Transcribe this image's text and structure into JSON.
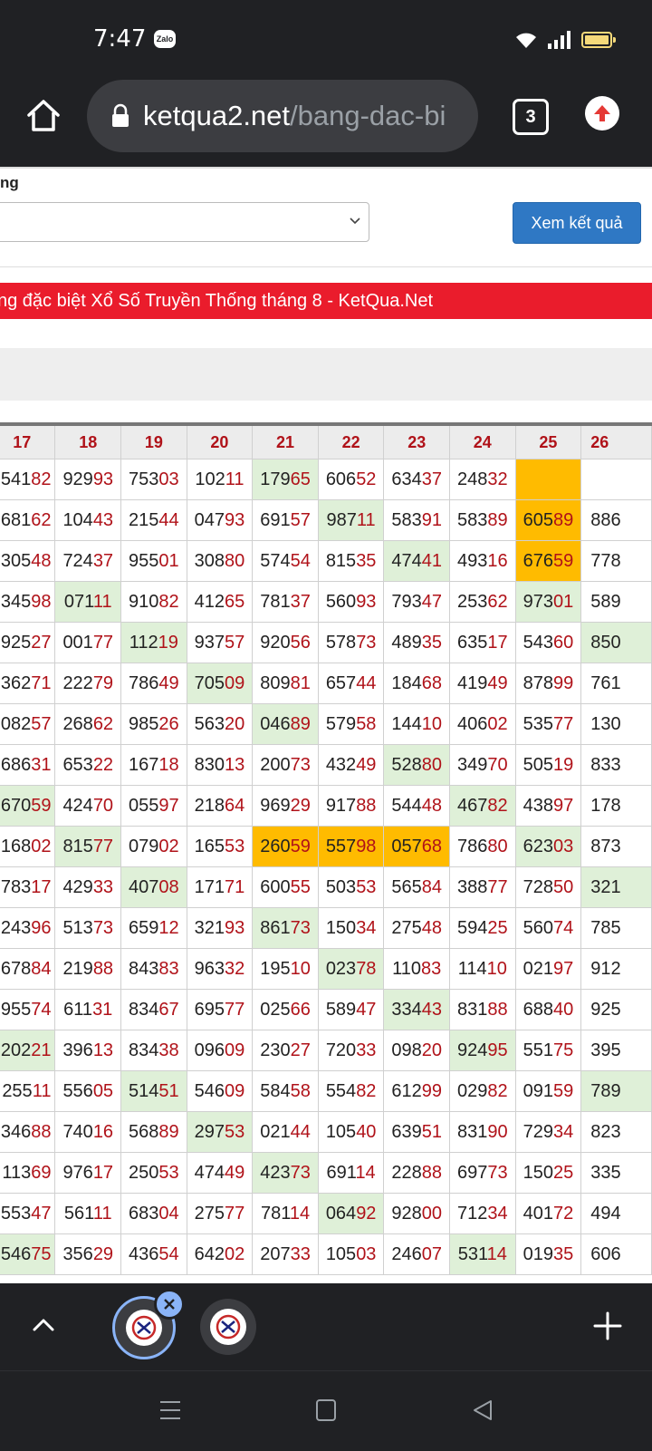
{
  "status": {
    "time": "7:47",
    "notification_icon_label": "Zalo"
  },
  "browser": {
    "url_host": "ketqua2.net",
    "url_path": "/bang-dac-bi",
    "tab_count": "3"
  },
  "form": {
    "label": "ng",
    "submit_label": "Xem kết quả"
  },
  "banner": {
    "title": "ng đặc biệt Xổ Số Truyền Thống tháng 8 - KetQua.Net"
  },
  "table": {
    "headers": [
      "17",
      "18",
      "19",
      "20",
      "21",
      "22",
      "23",
      "24",
      "25",
      "26"
    ],
    "rows": [
      [
        {
          "t": "54182",
          "h": ""
        },
        {
          "t": "92993",
          "h": ""
        },
        {
          "t": "75303",
          "h": ""
        },
        {
          "t": "10211",
          "h": ""
        },
        {
          "t": "17965",
          "h": "g"
        },
        {
          "t": "60652",
          "h": ""
        },
        {
          "t": "63437",
          "h": ""
        },
        {
          "t": "24832",
          "h": ""
        },
        {
          "t": "",
          "h": "o"
        },
        {
          "t": "",
          "h": ""
        }
      ],
      [
        {
          "t": "68162",
          "h": ""
        },
        {
          "t": "10443",
          "h": ""
        },
        {
          "t": "21544",
          "h": ""
        },
        {
          "t": "04793",
          "h": ""
        },
        {
          "t": "69157",
          "h": ""
        },
        {
          "t": "98711",
          "h": "g"
        },
        {
          "t": "58391",
          "h": ""
        },
        {
          "t": "58389",
          "h": ""
        },
        {
          "t": "60589",
          "h": "o"
        },
        {
          "t": "886",
          "h": ""
        }
      ],
      [
        {
          "t": "30548",
          "h": ""
        },
        {
          "t": "72437",
          "h": ""
        },
        {
          "t": "95501",
          "h": ""
        },
        {
          "t": "30880",
          "h": ""
        },
        {
          "t": "57454",
          "h": ""
        },
        {
          "t": "81535",
          "h": ""
        },
        {
          "t": "47441",
          "h": "g"
        },
        {
          "t": "49316",
          "h": ""
        },
        {
          "t": "67659",
          "h": "o"
        },
        {
          "t": "778",
          "h": ""
        }
      ],
      [
        {
          "t": "34598",
          "h": ""
        },
        {
          "t": "07111",
          "h": "g"
        },
        {
          "t": "91082",
          "h": ""
        },
        {
          "t": "41265",
          "h": ""
        },
        {
          "t": "78137",
          "h": ""
        },
        {
          "t": "56093",
          "h": ""
        },
        {
          "t": "79347",
          "h": ""
        },
        {
          "t": "25362",
          "h": ""
        },
        {
          "t": "97301",
          "h": "g"
        },
        {
          "t": "589",
          "h": ""
        }
      ],
      [
        {
          "t": "92527",
          "h": ""
        },
        {
          "t": "00177",
          "h": ""
        },
        {
          "t": "11219",
          "h": "g"
        },
        {
          "t": "93757",
          "h": ""
        },
        {
          "t": "92056",
          "h": ""
        },
        {
          "t": "57873",
          "h": ""
        },
        {
          "t": "48935",
          "h": ""
        },
        {
          "t": "63517",
          "h": ""
        },
        {
          "t": "54360",
          "h": ""
        },
        {
          "t": "850",
          "h": "g"
        }
      ],
      [
        {
          "t": "36271",
          "h": ""
        },
        {
          "t": "22279",
          "h": ""
        },
        {
          "t": "78649",
          "h": ""
        },
        {
          "t": "70509",
          "h": "g"
        },
        {
          "t": "80981",
          "h": ""
        },
        {
          "t": "65744",
          "h": ""
        },
        {
          "t": "18468",
          "h": ""
        },
        {
          "t": "41949",
          "h": ""
        },
        {
          "t": "87899",
          "h": ""
        },
        {
          "t": "761",
          "h": ""
        }
      ],
      [
        {
          "t": "08257",
          "h": ""
        },
        {
          "t": "26862",
          "h": ""
        },
        {
          "t": "98526",
          "h": ""
        },
        {
          "t": "56320",
          "h": ""
        },
        {
          "t": "04689",
          "h": "g"
        },
        {
          "t": "57958",
          "h": ""
        },
        {
          "t": "14410",
          "h": ""
        },
        {
          "t": "40602",
          "h": ""
        },
        {
          "t": "53577",
          "h": ""
        },
        {
          "t": "130",
          "h": ""
        }
      ],
      [
        {
          "t": "68631",
          "h": ""
        },
        {
          "t": "65322",
          "h": ""
        },
        {
          "t": "16718",
          "h": ""
        },
        {
          "t": "83013",
          "h": ""
        },
        {
          "t": "20073",
          "h": ""
        },
        {
          "t": "43249",
          "h": ""
        },
        {
          "t": "52880",
          "h": "g"
        },
        {
          "t": "34970",
          "h": ""
        },
        {
          "t": "50519",
          "h": ""
        },
        {
          "t": "833",
          "h": ""
        }
      ],
      [
        {
          "t": "67059",
          "h": "g"
        },
        {
          "t": "42470",
          "h": ""
        },
        {
          "t": "05597",
          "h": ""
        },
        {
          "t": "21864",
          "h": ""
        },
        {
          "t": "96929",
          "h": ""
        },
        {
          "t": "91788",
          "h": ""
        },
        {
          "t": "54448",
          "h": ""
        },
        {
          "t": "46782",
          "h": "g"
        },
        {
          "t": "43897",
          "h": ""
        },
        {
          "t": "178",
          "h": ""
        }
      ],
      [
        {
          "t": "16802",
          "h": ""
        },
        {
          "t": "81577",
          "h": "g"
        },
        {
          "t": "07902",
          "h": ""
        },
        {
          "t": "16553",
          "h": ""
        },
        {
          "t": "26059",
          "h": "o"
        },
        {
          "t": "55798",
          "h": "o"
        },
        {
          "t": "05768",
          "h": "o"
        },
        {
          "t": "78680",
          "h": ""
        },
        {
          "t": "62303",
          "h": "g"
        },
        {
          "t": "873",
          "h": ""
        }
      ],
      [
        {
          "t": "78317",
          "h": ""
        },
        {
          "t": "42933",
          "h": ""
        },
        {
          "t": "40708",
          "h": "g"
        },
        {
          "t": "17171",
          "h": ""
        },
        {
          "t": "60055",
          "h": ""
        },
        {
          "t": "50353",
          "h": ""
        },
        {
          "t": "56584",
          "h": ""
        },
        {
          "t": "38877",
          "h": ""
        },
        {
          "t": "72850",
          "h": ""
        },
        {
          "t": "321",
          "h": "g"
        }
      ],
      [
        {
          "t": "24396",
          "h": ""
        },
        {
          "t": "51373",
          "h": ""
        },
        {
          "t": "65912",
          "h": ""
        },
        {
          "t": "32193",
          "h": ""
        },
        {
          "t": "86173",
          "h": "g"
        },
        {
          "t": "15034",
          "h": ""
        },
        {
          "t": "27548",
          "h": ""
        },
        {
          "t": "59425",
          "h": ""
        },
        {
          "t": "56074",
          "h": ""
        },
        {
          "t": "785",
          "h": ""
        }
      ],
      [
        {
          "t": "67884",
          "h": ""
        },
        {
          "t": "21988",
          "h": ""
        },
        {
          "t": "84383",
          "h": ""
        },
        {
          "t": "96332",
          "h": ""
        },
        {
          "t": "19510",
          "h": ""
        },
        {
          "t": "02378",
          "h": "g"
        },
        {
          "t": "11083",
          "h": ""
        },
        {
          "t": "11410",
          "h": ""
        },
        {
          "t": "02197",
          "h": ""
        },
        {
          "t": "912",
          "h": ""
        }
      ],
      [
        {
          "t": "95574",
          "h": ""
        },
        {
          "t": "61131",
          "h": ""
        },
        {
          "t": "83467",
          "h": ""
        },
        {
          "t": "69577",
          "h": ""
        },
        {
          "t": "02566",
          "h": ""
        },
        {
          "t": "58947",
          "h": ""
        },
        {
          "t": "33443",
          "h": "g"
        },
        {
          "t": "83188",
          "h": ""
        },
        {
          "t": "68840",
          "h": ""
        },
        {
          "t": "925",
          "h": ""
        }
      ],
      [
        {
          "t": "20221",
          "h": "g"
        },
        {
          "t": "39613",
          "h": ""
        },
        {
          "t": "83438",
          "h": ""
        },
        {
          "t": "09609",
          "h": ""
        },
        {
          "t": "23027",
          "h": ""
        },
        {
          "t": "72033",
          "h": ""
        },
        {
          "t": "09820",
          "h": ""
        },
        {
          "t": "92495",
          "h": "g"
        },
        {
          "t": "55175",
          "h": ""
        },
        {
          "t": "395",
          "h": ""
        }
      ],
      [
        {
          "t": "25511",
          "h": ""
        },
        {
          "t": "55605",
          "h": ""
        },
        {
          "t": "51451",
          "h": "g"
        },
        {
          "t": "54609",
          "h": ""
        },
        {
          "t": "58458",
          "h": ""
        },
        {
          "t": "55482",
          "h": ""
        },
        {
          "t": "61299",
          "h": ""
        },
        {
          "t": "02982",
          "h": ""
        },
        {
          "t": "09159",
          "h": ""
        },
        {
          "t": "789",
          "h": "g"
        }
      ],
      [
        {
          "t": "34688",
          "h": ""
        },
        {
          "t": "74016",
          "h": ""
        },
        {
          "t": "56889",
          "h": ""
        },
        {
          "t": "29753",
          "h": "g"
        },
        {
          "t": "02144",
          "h": ""
        },
        {
          "t": "10540",
          "h": ""
        },
        {
          "t": "63951",
          "h": ""
        },
        {
          "t": "83190",
          "h": ""
        },
        {
          "t": "72934",
          "h": ""
        },
        {
          "t": "823",
          "h": ""
        }
      ],
      [
        {
          "t": "11369",
          "h": ""
        },
        {
          "t": "97617",
          "h": ""
        },
        {
          "t": "25053",
          "h": ""
        },
        {
          "t": "47449",
          "h": ""
        },
        {
          "t": "42373",
          "h": "g"
        },
        {
          "t": "69114",
          "h": ""
        },
        {
          "t": "22888",
          "h": ""
        },
        {
          "t": "69773",
          "h": ""
        },
        {
          "t": "15025",
          "h": ""
        },
        {
          "t": "335",
          "h": ""
        }
      ],
      [
        {
          "t": "55347",
          "h": ""
        },
        {
          "t": "56111",
          "h": ""
        },
        {
          "t": "68304",
          "h": ""
        },
        {
          "t": "27577",
          "h": ""
        },
        {
          "t": "78114",
          "h": ""
        },
        {
          "t": "06492",
          "h": "g"
        },
        {
          "t": "92800",
          "h": ""
        },
        {
          "t": "71234",
          "h": ""
        },
        {
          "t": "40172",
          "h": ""
        },
        {
          "t": "494",
          "h": ""
        }
      ],
      [
        {
          "t": "54675",
          "h": "g"
        },
        {
          "t": "35629",
          "h": ""
        },
        {
          "t": "43654",
          "h": ""
        },
        {
          "t": "64202",
          "h": ""
        },
        {
          "t": "20733",
          "h": ""
        },
        {
          "t": "10503",
          "h": ""
        },
        {
          "t": "24607",
          "h": ""
        },
        {
          "t": "53114",
          "h": "g"
        },
        {
          "t": "01935",
          "h": ""
        },
        {
          "t": "606",
          "h": ""
        }
      ]
    ]
  },
  "colors": {
    "accent_red": "#ea1c2c",
    "digit_red": "#b01219",
    "highlight_green": "#dff0d8",
    "highlight_orange": "#ffbb00",
    "button_blue": "#2f78c4"
  },
  "icons": [
    "home-icon",
    "lock-icon",
    "tab-switcher-icon",
    "update-icon",
    "chevron-up-icon",
    "close-icon",
    "plus-icon",
    "nav-menu-icon",
    "nav-home-icon",
    "nav-back-icon"
  ]
}
